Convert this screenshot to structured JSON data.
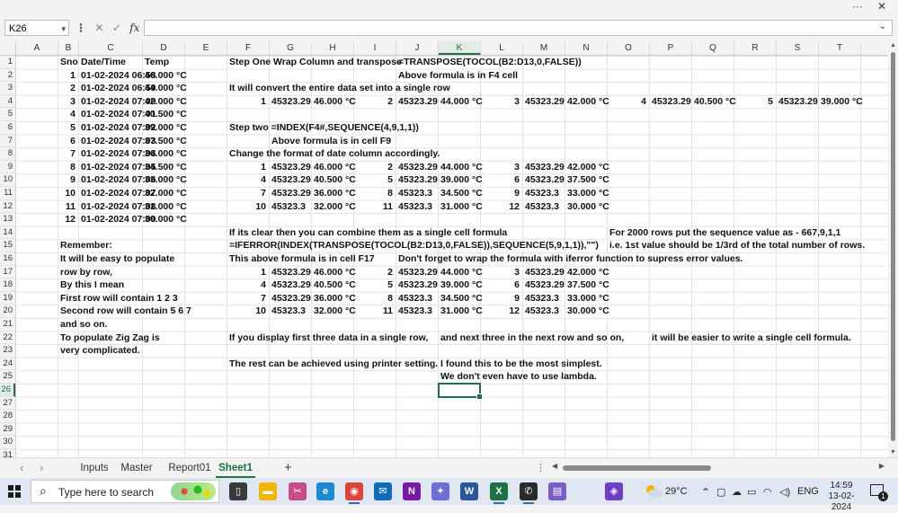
{
  "window": {
    "more_label": "···",
    "close_label": "✕"
  },
  "formula_bar": {
    "name_box": "K26",
    "formula": "",
    "cancel_icon": "✕",
    "enter_icon": "✓",
    "fx_label": "fx"
  },
  "columns": [
    "A",
    "B",
    "C",
    "D",
    "E",
    "F",
    "G",
    "H",
    "I",
    "J",
    "K",
    "L",
    "M",
    "N",
    "O",
    "P",
    "Q",
    "R",
    "S",
    "T"
  ],
  "selected_column": "K",
  "rows": [
    "1",
    "2",
    "3",
    "4",
    "5",
    "6",
    "7",
    "8",
    "9",
    "10",
    "11",
    "12",
    "13",
    "14",
    "15",
    "16",
    "17",
    "18",
    "19",
    "20",
    "21",
    "22",
    "23",
    "24",
    "25",
    "26",
    "27",
    "28",
    "29",
    "30",
    "31"
  ],
  "selected_row": "26",
  "cells": [
    {
      "ref": "B1",
      "text": "Sno"
    },
    {
      "ref": "C1",
      "text": "Date/Time"
    },
    {
      "ref": "D1",
      "text": "Temp"
    },
    {
      "ref": "F1",
      "text": "Step One Wrap Column and transpose"
    },
    {
      "ref": "J1",
      "text": "=TRANSPOSE(TOCOL(B2:D13,0,FALSE))"
    },
    {
      "ref": "B2",
      "text": "1",
      "align": "r"
    },
    {
      "ref": "C2",
      "text": "01-02-2024 06:58"
    },
    {
      "ref": "D2",
      "text": "46.000 °C"
    },
    {
      "ref": "J2",
      "text": "Above formula is in F4 cell"
    },
    {
      "ref": "B3",
      "text": "2",
      "align": "r"
    },
    {
      "ref": "C3",
      "text": "01-02-2024 06:59"
    },
    {
      "ref": "D3",
      "text": "44.000 °C"
    },
    {
      "ref": "F3",
      "text": "It will convert the entire data set into a single row"
    },
    {
      "ref": "B4",
      "text": "3",
      "align": "r"
    },
    {
      "ref": "C4",
      "text": "01-02-2024 07:00"
    },
    {
      "ref": "D4",
      "text": "42.000 °C"
    },
    {
      "ref": "F4",
      "text": "1",
      "align": "r"
    },
    {
      "ref": "G4",
      "text": "45323.29"
    },
    {
      "ref": "H4",
      "text": "46.000 °C"
    },
    {
      "ref": "I4",
      "text": "2",
      "align": "r"
    },
    {
      "ref": "J4",
      "text": "45323.29"
    },
    {
      "ref": "K4",
      "text": "44.000 °C"
    },
    {
      "ref": "L4",
      "text": "3",
      "align": "r"
    },
    {
      "ref": "M4",
      "text": "45323.29"
    },
    {
      "ref": "N4",
      "text": "42.000 °C"
    },
    {
      "ref": "O4",
      "text": "4",
      "align": "r"
    },
    {
      "ref": "P4",
      "text": "45323.29"
    },
    {
      "ref": "Q4",
      "text": "40.500 °C"
    },
    {
      "ref": "R4",
      "text": "5",
      "align": "r"
    },
    {
      "ref": "S4",
      "text": "45323.29"
    },
    {
      "ref": "T4",
      "text": "39.000 °C"
    },
    {
      "ref": "B5",
      "text": "4",
      "align": "r"
    },
    {
      "ref": "C5",
      "text": "01-02-2024 07:01"
    },
    {
      "ref": "D5",
      "text": "40.500 °C"
    },
    {
      "ref": "B6",
      "text": "5",
      "align": "r"
    },
    {
      "ref": "C6",
      "text": "01-02-2024 07:02"
    },
    {
      "ref": "D6",
      "text": "39.000 °C"
    },
    {
      "ref": "F6",
      "text": "Step two  =INDEX(F4#,SEQUENCE(4,9,1,1))"
    },
    {
      "ref": "B7",
      "text": "6",
      "align": "r"
    },
    {
      "ref": "C7",
      "text": "01-02-2024 07:03"
    },
    {
      "ref": "D7",
      "text": "37.500 °C"
    },
    {
      "ref": "G7",
      "text": "Above formula is in cell F9"
    },
    {
      "ref": "B8",
      "text": "7",
      "align": "r"
    },
    {
      "ref": "C8",
      "text": "01-02-2024 07:04"
    },
    {
      "ref": "D8",
      "text": "36.000 °C"
    },
    {
      "ref": "F8",
      "text": "Change the format of date column accordingly."
    },
    {
      "ref": "B9",
      "text": "8",
      "align": "r"
    },
    {
      "ref": "C9",
      "text": "01-02-2024 07:05"
    },
    {
      "ref": "D9",
      "text": "34.500 °C"
    },
    {
      "ref": "F9",
      "text": "1",
      "align": "r"
    },
    {
      "ref": "G9",
      "text": "45323.29"
    },
    {
      "ref": "H9",
      "text": "46.000 °C"
    },
    {
      "ref": "I9",
      "text": "2",
      "align": "r"
    },
    {
      "ref": "J9",
      "text": "45323.29"
    },
    {
      "ref": "K9",
      "text": "44.000 °C"
    },
    {
      "ref": "L9",
      "text": "3",
      "align": "r"
    },
    {
      "ref": "M9",
      "text": "45323.29"
    },
    {
      "ref": "N9",
      "text": "42.000 °C"
    },
    {
      "ref": "B10",
      "text": "9",
      "align": "r"
    },
    {
      "ref": "C10",
      "text": "01-02-2024 07:06"
    },
    {
      "ref": "D10",
      "text": "33.000 °C"
    },
    {
      "ref": "F10",
      "text": "4",
      "align": "r"
    },
    {
      "ref": "G10",
      "text": "45323.29"
    },
    {
      "ref": "H10",
      "text": "40.500 °C"
    },
    {
      "ref": "I10",
      "text": "5",
      "align": "r"
    },
    {
      "ref": "J10",
      "text": "45323.29"
    },
    {
      "ref": "K10",
      "text": "39.000 °C"
    },
    {
      "ref": "L10",
      "text": "6",
      "align": "r"
    },
    {
      "ref": "M10",
      "text": "45323.29"
    },
    {
      "ref": "N10",
      "text": "37.500 °C"
    },
    {
      "ref": "B11",
      "text": "10",
      "align": "r"
    },
    {
      "ref": "C11",
      "text": "01-02-2024 07:07"
    },
    {
      "ref": "D11",
      "text": "32.000 °C"
    },
    {
      "ref": "F11",
      "text": "7",
      "align": "r"
    },
    {
      "ref": "G11",
      "text": "45323.29"
    },
    {
      "ref": "H11",
      "text": "36.000 °C"
    },
    {
      "ref": "I11",
      "text": "8",
      "align": "r"
    },
    {
      "ref": "J11",
      "text": "45323.3"
    },
    {
      "ref": "K11",
      "text": "34.500 °C"
    },
    {
      "ref": "L11",
      "text": "9",
      "align": "r"
    },
    {
      "ref": "M11",
      "text": "45323.3"
    },
    {
      "ref": "N11",
      "text": "33.000 °C"
    },
    {
      "ref": "B12",
      "text": "11",
      "align": "r"
    },
    {
      "ref": "C12",
      "text": "01-02-2024 07:08"
    },
    {
      "ref": "D12",
      "text": "31.000 °C"
    },
    {
      "ref": "F12",
      "text": "10",
      "align": "r"
    },
    {
      "ref": "G12",
      "text": "45323.3"
    },
    {
      "ref": "H12",
      "text": "32.000 °C"
    },
    {
      "ref": "I12",
      "text": "11",
      "align": "r"
    },
    {
      "ref": "J12",
      "text": "45323.3"
    },
    {
      "ref": "K12",
      "text": "31.000 °C"
    },
    {
      "ref": "L12",
      "text": "12",
      "align": "r"
    },
    {
      "ref": "M12",
      "text": "45323.3"
    },
    {
      "ref": "N12",
      "text": "30.000 °C"
    },
    {
      "ref": "B13",
      "text": "12",
      "align": "r"
    },
    {
      "ref": "C13",
      "text": "01-02-2024 07:09"
    },
    {
      "ref": "D13",
      "text": "30.000 °C"
    },
    {
      "ref": "F14",
      "text": "If its clear then you can combine them as a single cell formula"
    },
    {
      "ref": "O14",
      "text": "For 2000 rows put the sequence value as - 667,9,1,1"
    },
    {
      "ref": "B15",
      "text": "Remember:"
    },
    {
      "ref": "F15",
      "text": "=IFERROR(INDEX(TRANSPOSE(TOCOL(B2:D13,0,FALSE)),SEQUENCE(5,9,1,1)),\"\")"
    },
    {
      "ref": "O15",
      "text": "i.e. 1st value should be 1/3rd of the total number of rows."
    },
    {
      "ref": "B16",
      "text": "It will be easy to populate"
    },
    {
      "ref": "F16",
      "text": "This above formula is in cell F17"
    },
    {
      "ref": "J16",
      "text": "Don't forget to wrap the formula with iferror function to supress error values."
    },
    {
      "ref": "B17",
      "text": "row by row,"
    },
    {
      "ref": "F17",
      "text": "1",
      "align": "r"
    },
    {
      "ref": "G17",
      "text": "45323.29"
    },
    {
      "ref": "H17",
      "text": "46.000 °C"
    },
    {
      "ref": "I17",
      "text": "2",
      "align": "r"
    },
    {
      "ref": "J17",
      "text": "45323.29"
    },
    {
      "ref": "K17",
      "text": "44.000 °C"
    },
    {
      "ref": "L17",
      "text": "3",
      "align": "r"
    },
    {
      "ref": "M17",
      "text": "45323.29"
    },
    {
      "ref": "N17",
      "text": "42.000 °C"
    },
    {
      "ref": "B18",
      "text": "By this I mean"
    },
    {
      "ref": "F18",
      "text": "4",
      "align": "r"
    },
    {
      "ref": "G18",
      "text": "45323.29"
    },
    {
      "ref": "H18",
      "text": "40.500 °C"
    },
    {
      "ref": "I18",
      "text": "5",
      "align": "r"
    },
    {
      "ref": "J18",
      "text": "45323.29"
    },
    {
      "ref": "K18",
      "text": "39.000 °C"
    },
    {
      "ref": "L18",
      "text": "6",
      "align": "r"
    },
    {
      "ref": "M18",
      "text": "45323.29"
    },
    {
      "ref": "N18",
      "text": "37.500 °C"
    },
    {
      "ref": "B19",
      "text": "First row will contain 1 2 3"
    },
    {
      "ref": "F19",
      "text": "7",
      "align": "r"
    },
    {
      "ref": "G19",
      "text": "45323.29"
    },
    {
      "ref": "H19",
      "text": "36.000 °C"
    },
    {
      "ref": "I19",
      "text": "8",
      "align": "r"
    },
    {
      "ref": "J19",
      "text": "45323.3"
    },
    {
      "ref": "K19",
      "text": "34.500 °C"
    },
    {
      "ref": "L19",
      "text": "9",
      "align": "r"
    },
    {
      "ref": "M19",
      "text": "45323.3"
    },
    {
      "ref": "N19",
      "text": "33.000 °C"
    },
    {
      "ref": "B20",
      "text": "Second row will contain 5 6 7"
    },
    {
      "ref": "F20",
      "text": "10",
      "align": "r"
    },
    {
      "ref": "G20",
      "text": "45323.3"
    },
    {
      "ref": "H20",
      "text": "32.000 °C"
    },
    {
      "ref": "I20",
      "text": "11",
      "align": "r"
    },
    {
      "ref": "J20",
      "text": "45323.3"
    },
    {
      "ref": "K20",
      "text": "31.000 °C"
    },
    {
      "ref": "L20",
      "text": "12",
      "align": "r"
    },
    {
      "ref": "M20",
      "text": "45323.3"
    },
    {
      "ref": "N20",
      "text": "30.000 °C"
    },
    {
      "ref": "B21",
      "text": "and so on."
    },
    {
      "ref": "B22",
      "text": "To populate Zig Zag is"
    },
    {
      "ref": "F22",
      "text": "If you display first three data in a single row,"
    },
    {
      "ref": "K22",
      "text": "and next three in the next row and so on,"
    },
    {
      "ref": "P22",
      "text": "it will be easier to write a single cell formula."
    },
    {
      "ref": "B23",
      "text": "very complicated."
    },
    {
      "ref": "F24",
      "text": "The rest can be achieved using printer setting."
    },
    {
      "ref": "K24",
      "text": "I found this to be the most simplest."
    },
    {
      "ref": "K25",
      "text": "We don't even have to use lambda."
    }
  ],
  "sheet_tabs": [
    "Inputs",
    "Master",
    "Report01",
    "Sheet1"
  ],
  "active_tab": "Sheet1",
  "sheetbar": {
    "prev": "‹",
    "next": "›",
    "add": "+",
    "dots": "⋮"
  },
  "taskbar": {
    "search_placeholder": "Type here to search",
    "weather": "29°C",
    "language": "ENG",
    "time": "14:59",
    "date": "13-02-2024",
    "notification_count": "1",
    "apps": [
      "task-view-icon",
      "file-explorer-icon",
      "snipping-tool-icon",
      "edge-icon",
      "chrome-icon",
      "mail-icon",
      "onenote-icon",
      "copilot-icon",
      "word-icon",
      "excel-icon",
      "whatsapp-icon",
      "media-icon",
      "vpn-icon"
    ]
  }
}
